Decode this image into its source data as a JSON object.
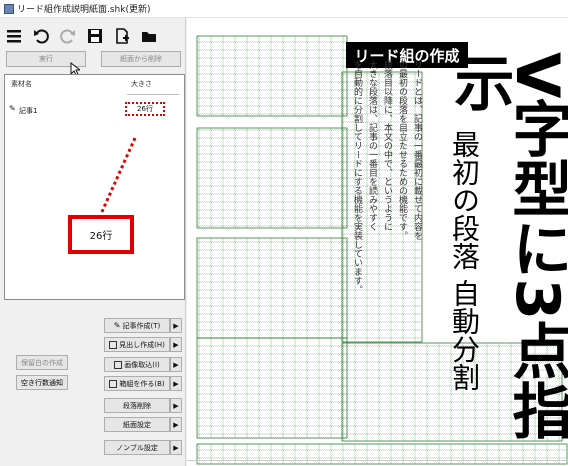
{
  "window": {
    "title": "リード組作成説明紙面.shk(更新)"
  },
  "toolbar": {
    "icons": [
      "menu-icon",
      "undo-icon",
      "redo-icon",
      "save-icon",
      "new-file-icon",
      "folder-icon"
    ]
  },
  "left_panel": {
    "execute_label": "実行",
    "delete_from_page_label": "紙面から削除",
    "material_list": {
      "header_name": "素材名",
      "header_size": "大きさ",
      "items": [
        {
          "name": "記事1",
          "size": "26行"
        }
      ]
    },
    "callout_value": "26行",
    "side_buttons": {
      "delete_blank": "保留白の作成",
      "notify_blank": "空き行数通知"
    },
    "right_buttons": [
      "記事作成(T)",
      "見出し作成(H)",
      "画像取込(I)",
      "箱組を作る(B)",
      "段落削除",
      "紙面設定",
      "ノンブル設定"
    ]
  },
  "page": {
    "pill_title": "リード組の作成",
    "big_title": "V字型に3点指示",
    "subtitle": "最初の段落 自動分割",
    "body_columns": [
      "リードとは、記事の一番最初に載せて内容を",
      "の最初の段落を目立たせるための機能です。",
      "段落目以降に、本文の中で、というように",
      "大きな段落は、記事の一番目を読みやすく",
      "を自動的に分割してリードにする機能を実装しています。"
    ]
  }
}
